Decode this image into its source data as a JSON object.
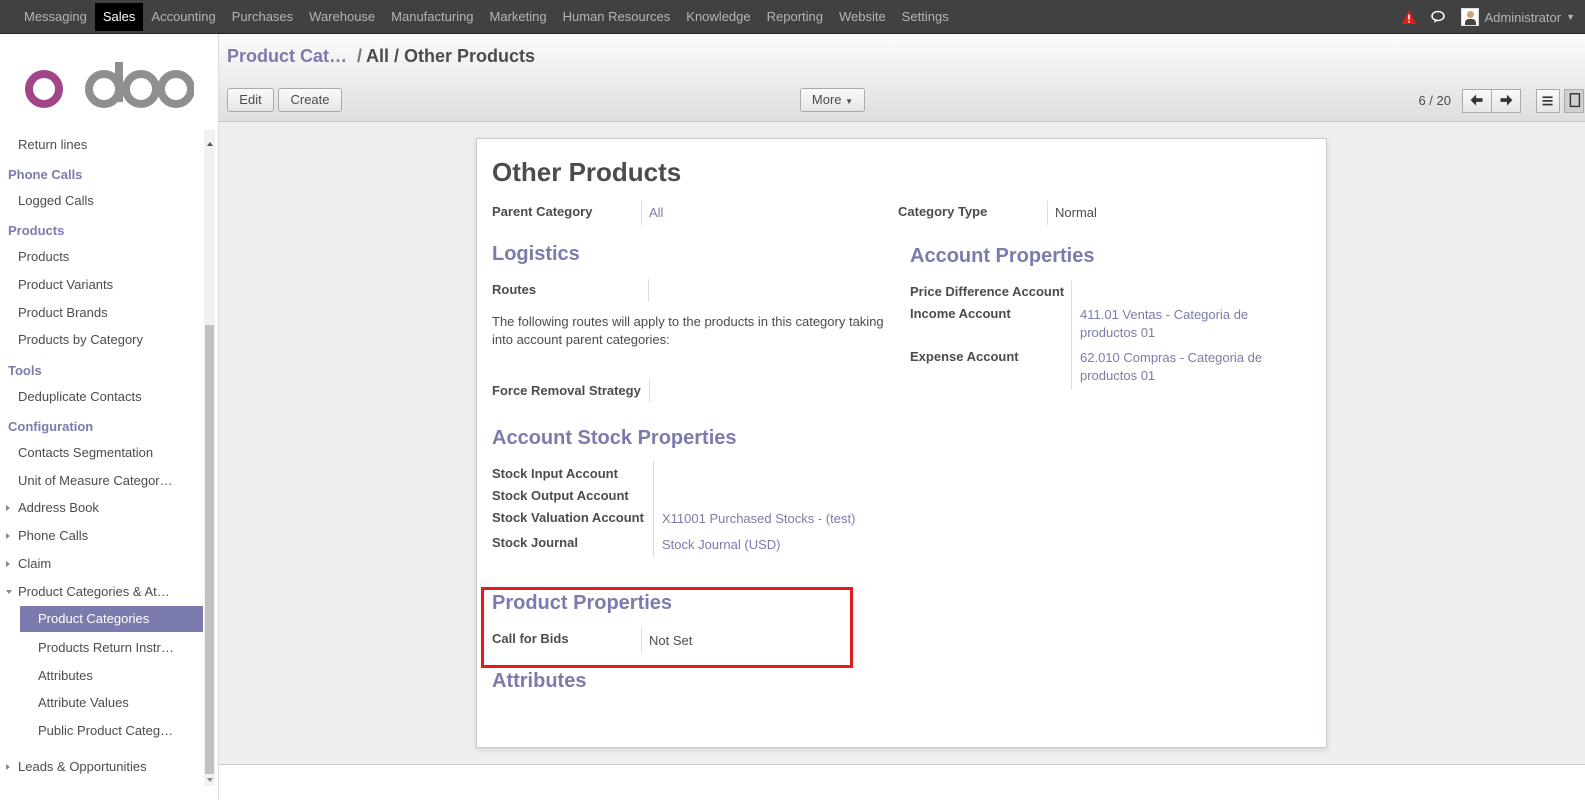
{
  "topbar": {
    "menu": [
      "Messaging",
      "Sales",
      "Accounting",
      "Purchases",
      "Warehouse",
      "Manufacturing",
      "Marketing",
      "Human Resources",
      "Knowledge",
      "Reporting",
      "Website",
      "Settings"
    ],
    "active": "Sales",
    "user": "Administrator"
  },
  "sidebar": {
    "return_lines": "Return lines",
    "phone_calls_head": "Phone Calls",
    "logged_calls": "Logged Calls",
    "products_head": "Products",
    "products": "Products",
    "product_variants": "Product Variants",
    "product_brands": "Product Brands",
    "products_by_category": "Products by Category",
    "tools_head": "Tools",
    "deduplicate_contacts": "Deduplicate Contacts",
    "configuration_head": "Configuration",
    "contacts_segmentation": "Contacts Segmentation",
    "uom_categories": "Unit of Measure Categor…",
    "address_book": "Address Book",
    "phone_calls": "Phone Calls",
    "claim": "Claim",
    "product_categories_attr": "Product Categories & At…",
    "product_categories": "Product Categories",
    "products_return_instr": "Products Return Instr…",
    "attributes": "Attributes",
    "attribute_values": "Attribute Values",
    "public_product_categ": "Public Product Categ…",
    "leads_opportunities": "Leads & Opportunities"
  },
  "control_panel": {
    "breadcrumb_link": "Product Cat…",
    "breadcrumb_sep": "/",
    "breadcrumb_current": "All / Other Products",
    "edit": "Edit",
    "create": "Create",
    "more": "More",
    "pager": "6 / 20"
  },
  "form": {
    "title": "Other Products",
    "parent_category_label": "Parent Category",
    "parent_category_value": "All",
    "category_type_label": "Category Type",
    "category_type_value": "Normal",
    "logistics_title": "Logistics",
    "routes_label": "Routes",
    "routes_help": "The following routes will apply to the products in this category taking into account parent categories:",
    "force_removal_label": "Force Removal Strategy",
    "account_properties_title": "Account Properties",
    "price_diff_label": "Price Difference Account",
    "income_label": "Income Account",
    "income_value": "411.01 Ventas - Categoria de productos 01",
    "expense_label": "Expense Account",
    "expense_value": "62.010 Compras - Categoria de productos 01",
    "account_stock_title": "Account Stock Properties",
    "stock_input_label": "Stock Input Account",
    "stock_output_label": "Stock Output Account",
    "stock_valuation_label": "Stock Valuation Account",
    "stock_valuation_value": "X11001 Purchased Stocks - (test)",
    "stock_journal_label": "Stock Journal",
    "stock_journal_value": "Stock Journal (USD)",
    "product_properties_title": "Product Properties",
    "call_for_bids_label": "Call for Bids",
    "call_for_bids_value": "Not Set",
    "attributes_title": "Attributes"
  },
  "colors": {
    "accent": "#7c7bad",
    "topbar": "#414141",
    "highlight": "#e31b1b"
  }
}
